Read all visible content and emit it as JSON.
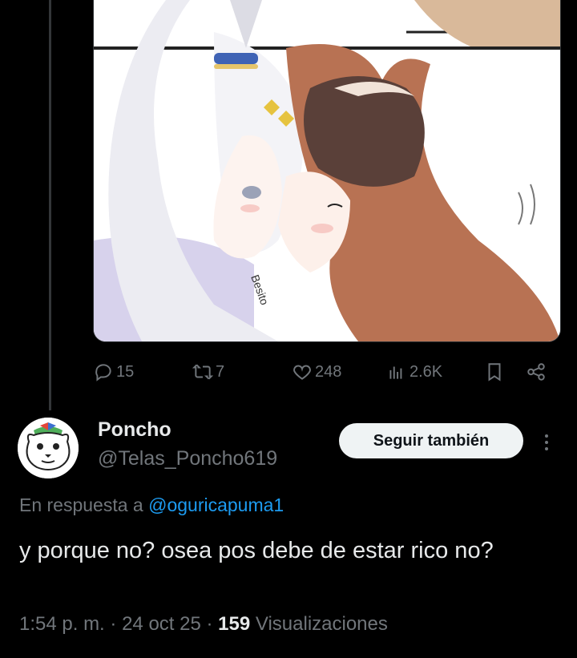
{
  "actions": {
    "replies": "15",
    "reposts": "7",
    "likes": "248",
    "views": "2.6K"
  },
  "reply": {
    "display_name": "Poncho",
    "handle": "@Telas_Poncho619",
    "follow_label": "Seguir también",
    "reply_prefix": "En respuesta a",
    "reply_mention": "@oguricapuma1",
    "text": "y porque no? osea pos debe de estar rico no?",
    "time": "1:54 p. m.",
    "date": "24 oct 25",
    "views_count": "159",
    "views_label": "Visualizaciones"
  },
  "media": {
    "caption": "Besito"
  },
  "colors": {
    "background": "#000000",
    "text_primary": "#e7e9ea",
    "text_secondary": "#71767b",
    "link": "#1d9bf0",
    "follow_button_bg": "#eff3f4"
  },
  "icons": [
    "reply-icon",
    "repost-icon",
    "like-icon",
    "views-icon",
    "bookmark-icon",
    "share-icon",
    "more-icon"
  ]
}
